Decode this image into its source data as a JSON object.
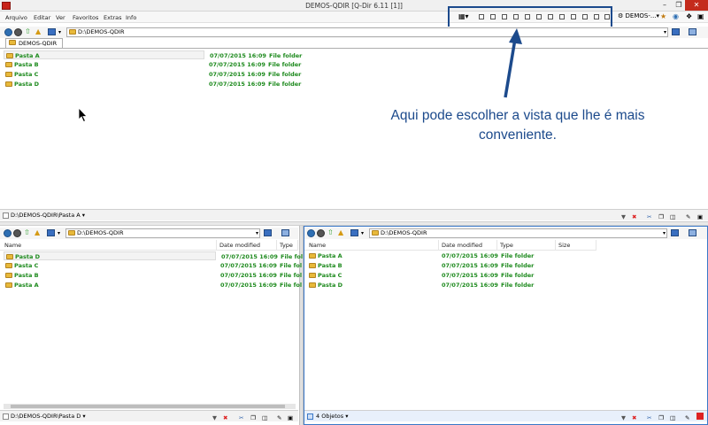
{
  "window": {
    "title": "DEMOS-QDIR  [Q-Dir 6.11 [1]]"
  },
  "menu": {
    "items": [
      "Arquivo",
      "Editar",
      "Ver",
      "Favoritos",
      "Extras",
      "Info"
    ]
  },
  "toolbar": {
    "profile_label": "DEMOS-..."
  },
  "callout": {
    "line1": "Aqui pode escolher a vista que lhe é mais",
    "line2": "conveniente."
  },
  "top_pane": {
    "tab_label": "DEMOS-QDIR",
    "address": "D:\\DEMOS-QDIR",
    "rows": [
      {
        "name": "Pasta A",
        "date": "07/07/2015 16:09",
        "type": "File folder"
      },
      {
        "name": "Pasta B",
        "date": "07/07/2015 16:09",
        "type": "File folder"
      },
      {
        "name": "Pasta C",
        "date": "07/07/2015 16:09",
        "type": "File folder"
      },
      {
        "name": "Pasta D",
        "date": "07/07/2015 16:09",
        "type": "File folder"
      }
    ],
    "status": "D:\\DEMOS-QDIR\\Pasta A"
  },
  "left_pane": {
    "address": "D:\\DEMOS-QDIR",
    "headers": {
      "name": "Name",
      "date": "Date modified",
      "type": "Type"
    },
    "rows": [
      {
        "name": "Pasta D",
        "date": "07/07/2015 16:09",
        "type": "File fol"
      },
      {
        "name": "Pasta C",
        "date": "07/07/2015 16:09",
        "type": "File fol"
      },
      {
        "name": "Pasta B",
        "date": "07/07/2015 16:09",
        "type": "File fol"
      },
      {
        "name": "Pasta A",
        "date": "07/07/2015 16:09",
        "type": "File fol"
      }
    ],
    "status": "D:\\DEMOS-QDIR\\Pasta D"
  },
  "right_pane": {
    "address": "D:\\DEMOS-QDIR",
    "headers": {
      "name": "Name",
      "date": "Date modified",
      "type": "Type",
      "size": "Size"
    },
    "rows": [
      {
        "name": "Pasta A",
        "date": "07/07/2015 16:09",
        "type": "File folder"
      },
      {
        "name": "Pasta B",
        "date": "07/07/2015 16:09",
        "type": "File folder"
      },
      {
        "name": "Pasta C",
        "date": "07/07/2015 16:09",
        "type": "File folder"
      },
      {
        "name": "Pasta D",
        "date": "07/07/2015 16:09",
        "type": "File folder"
      }
    ],
    "status": "4 Objetos"
  },
  "colors": {
    "folder_text": "#1d8a1d",
    "accent": "#1c4a8c",
    "close": "#c42b1c"
  }
}
